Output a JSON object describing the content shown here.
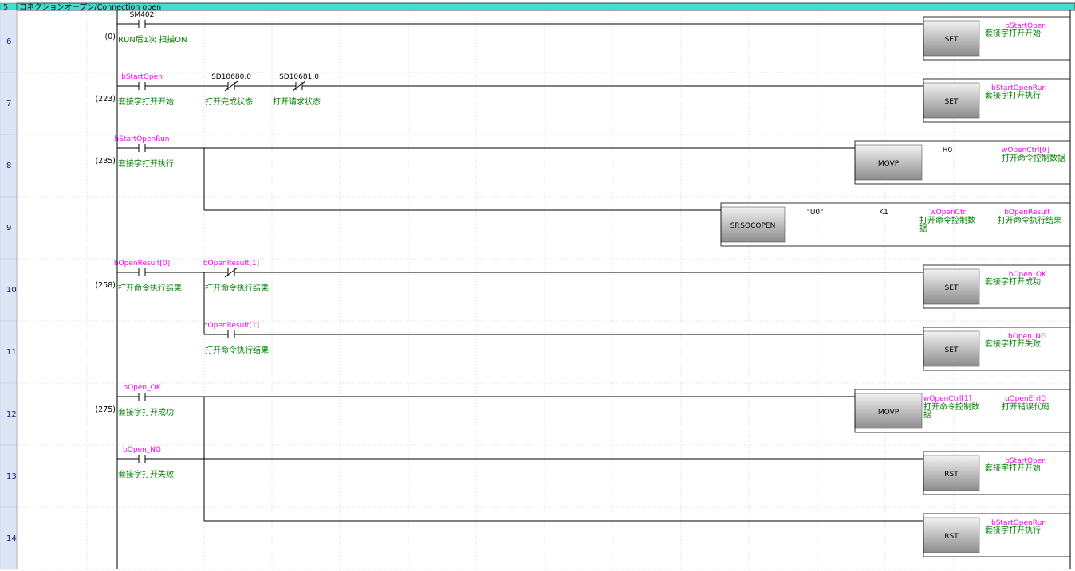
{
  "header": {
    "number": "5",
    "title": "コネクションオープン/Connection open"
  },
  "colors": {
    "header_bg": "#40e0d0",
    "rownum_bg": "#dbe5f6",
    "device": "#ff00ff",
    "comment": "#008000",
    "wire": "#000000"
  },
  "rows": [
    {
      "num": "6",
      "step": "(0)",
      "contacts": [
        {
          "col": 0,
          "type": "NO",
          "device": "SM402",
          "devColor": "black",
          "comment": "RUN后1次 扫描ON"
        }
      ],
      "instr": {
        "kind": "coil",
        "name": "SET",
        "operands": [
          {
            "text": "bStartOpen",
            "color": "magenta",
            "comment": "套接字打开开始"
          }
        ]
      }
    },
    {
      "num": "7",
      "step": "(223)",
      "contacts": [
        {
          "col": 0,
          "type": "NO",
          "device": "bStartOpen",
          "devColor": "magenta",
          "comment": "套接字打开开始"
        },
        {
          "col": 1,
          "type": "NC",
          "device": "SD10680.0",
          "devColor": "black",
          "comment": "打开完成状态"
        },
        {
          "col": 2,
          "type": "NC",
          "device": "SD10681.0",
          "devColor": "black",
          "comment": "打开请求状态"
        }
      ],
      "instr": {
        "kind": "coil",
        "name": "SET",
        "operands": [
          {
            "text": "bStartOpenRun",
            "color": "magenta",
            "comment": "套接字打开执行"
          }
        ]
      }
    },
    {
      "num": "8",
      "step": "(235)",
      "contacts": [
        {
          "col": 0,
          "type": "NO",
          "device": "bStartOpenRun",
          "devColor": "magenta",
          "comment": "套接字打开执行"
        }
      ],
      "instr": {
        "kind": "mid",
        "name": "MOVP",
        "operands": [
          {
            "text": "H0",
            "color": "black",
            "comment": ""
          },
          {
            "text": "wOpenCtrl[0]",
            "color": "magenta",
            "comment": "打开命令控制数据"
          }
        ]
      }
    },
    {
      "num": "9",
      "step": "",
      "contacts": [],
      "instr": {
        "kind": "long",
        "name": "SP.SOCOPEN",
        "operands": [
          {
            "text": "\"U0\"",
            "color": "black",
            "comment": ""
          },
          {
            "text": "K1",
            "color": "black",
            "comment": ""
          },
          {
            "text": "wOpenCtrl",
            "color": "magenta",
            "comment": "打开命令控制数\n据"
          },
          {
            "text": "bOpenResult",
            "color": "magenta",
            "comment": "打开命令执行结果"
          }
        ]
      }
    },
    {
      "num": "10",
      "step": "(258)",
      "contacts": [
        {
          "col": 0,
          "type": "NO",
          "device": "bOpenResult[0]",
          "devColor": "magenta",
          "comment": "打开命令执行结果"
        },
        {
          "col": 1,
          "type": "NC",
          "device": "bOpenResult[1]",
          "devColor": "magenta",
          "comment": "打开命令执行结果"
        }
      ],
      "instr": {
        "kind": "coil",
        "name": "SET",
        "operands": [
          {
            "text": "bOpen_OK",
            "color": "magenta",
            "comment": "套接字打开成功"
          }
        ]
      }
    },
    {
      "num": "11",
      "step": "",
      "contacts": [
        {
          "col": 1,
          "type": "NO",
          "device": "bOpenResult[1]",
          "devColor": "magenta",
          "comment": "打开命令执行结果"
        }
      ],
      "instr": {
        "kind": "coil",
        "name": "SET",
        "operands": [
          {
            "text": "bOpen_NG",
            "color": "magenta",
            "comment": "套接字打开失败"
          }
        ]
      }
    },
    {
      "num": "12",
      "step": "(275)",
      "contacts": [
        {
          "col": 0,
          "type": "NO",
          "device": "bOpen_OK",
          "devColor": "magenta",
          "comment": "套接字打开成功"
        }
      ],
      "instr": {
        "kind": "mid",
        "name": "MOVP",
        "operands": [
          {
            "text": "wOpenCtrl[1]",
            "color": "magenta",
            "comment": "打开命令控制数\n据"
          },
          {
            "text": "uOpenErrID",
            "color": "magenta",
            "comment": "打开错误代码"
          }
        ]
      }
    },
    {
      "num": "13",
      "step": "",
      "contacts": [
        {
          "col": 0,
          "type": "NO",
          "device": "bOpen_NG",
          "devColor": "magenta",
          "comment": "套接字打开失败"
        }
      ],
      "instr": {
        "kind": "coil",
        "name": "RST",
        "operands": [
          {
            "text": "bStartOpen",
            "color": "magenta",
            "comment": "套接字打开开始"
          }
        ]
      }
    },
    {
      "num": "14",
      "step": "",
      "contacts": [],
      "instr": {
        "kind": "coil",
        "name": "RST",
        "operands": [
          {
            "text": "bStartOpenRun",
            "color": "magenta",
            "comment": "套接字打开执行"
          }
        ]
      }
    }
  ]
}
